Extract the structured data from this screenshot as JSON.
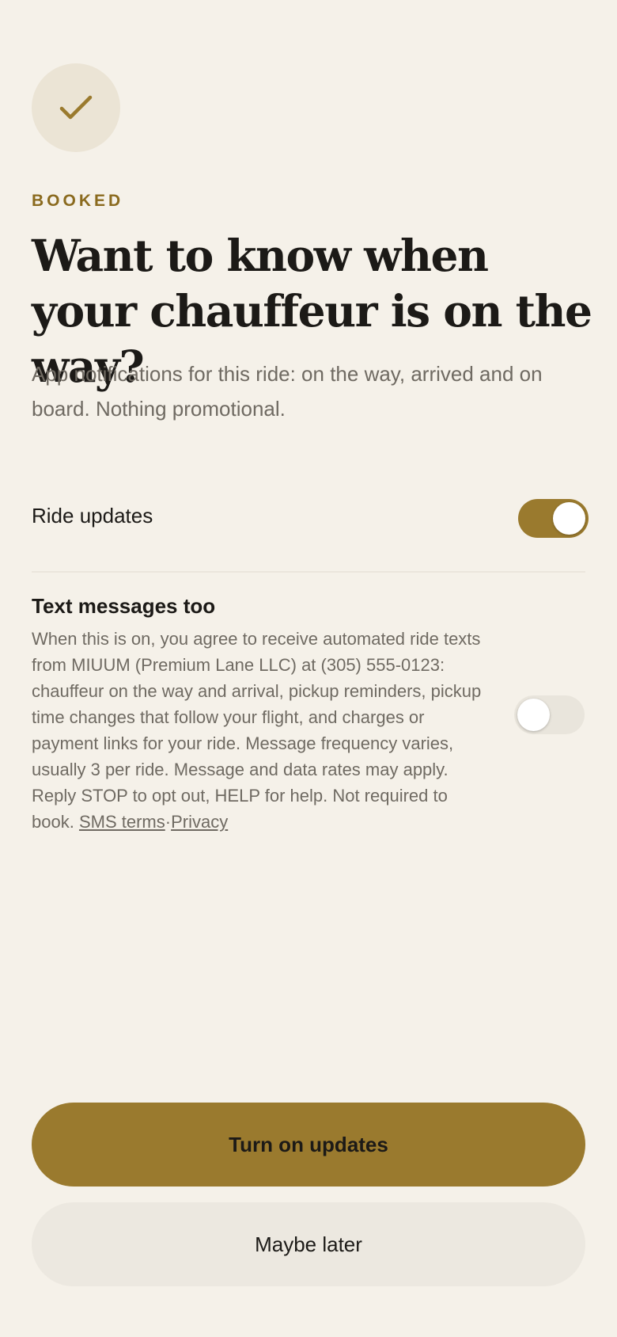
{
  "header": {
    "icon": "checkmark-icon",
    "eyebrow": "BOOKED",
    "title": "Want to know when your chauffeur is on the way?",
    "subtitle": "App notifications for this ride: on the way, arrived and on board. Nothing promotional."
  },
  "ride_updates": {
    "label": "Ride updates",
    "enabled": true
  },
  "text_messages": {
    "title": "Text messages too",
    "body": "When this is on, you agree to receive automated ride texts from MIUUM (Premium Lane LLC) at (305) 555-0123: chauffeur on the way and arrival, pickup reminders, pickup time changes that follow your flight, and charges or payment links for your ride. Message frequency varies, usually 3 per ride. Message and data rates may apply. Reply STOP to opt out, HELP for help. Not required to book.",
    "sms_terms_link": "SMS terms",
    "separator": "·",
    "privacy_link": "Privacy",
    "enabled": false
  },
  "actions": {
    "primary_label": "Turn on updates",
    "secondary_label": "Maybe later"
  },
  "colors": {
    "background": "#f5f1e9",
    "accent": "#9a7a2e",
    "eyebrow": "#8a6a1e",
    "text_primary": "#1c1a17",
    "text_secondary": "#6f6a62",
    "toggle_off": "#e9e5dc",
    "secondary_button": "#ece8e0"
  }
}
